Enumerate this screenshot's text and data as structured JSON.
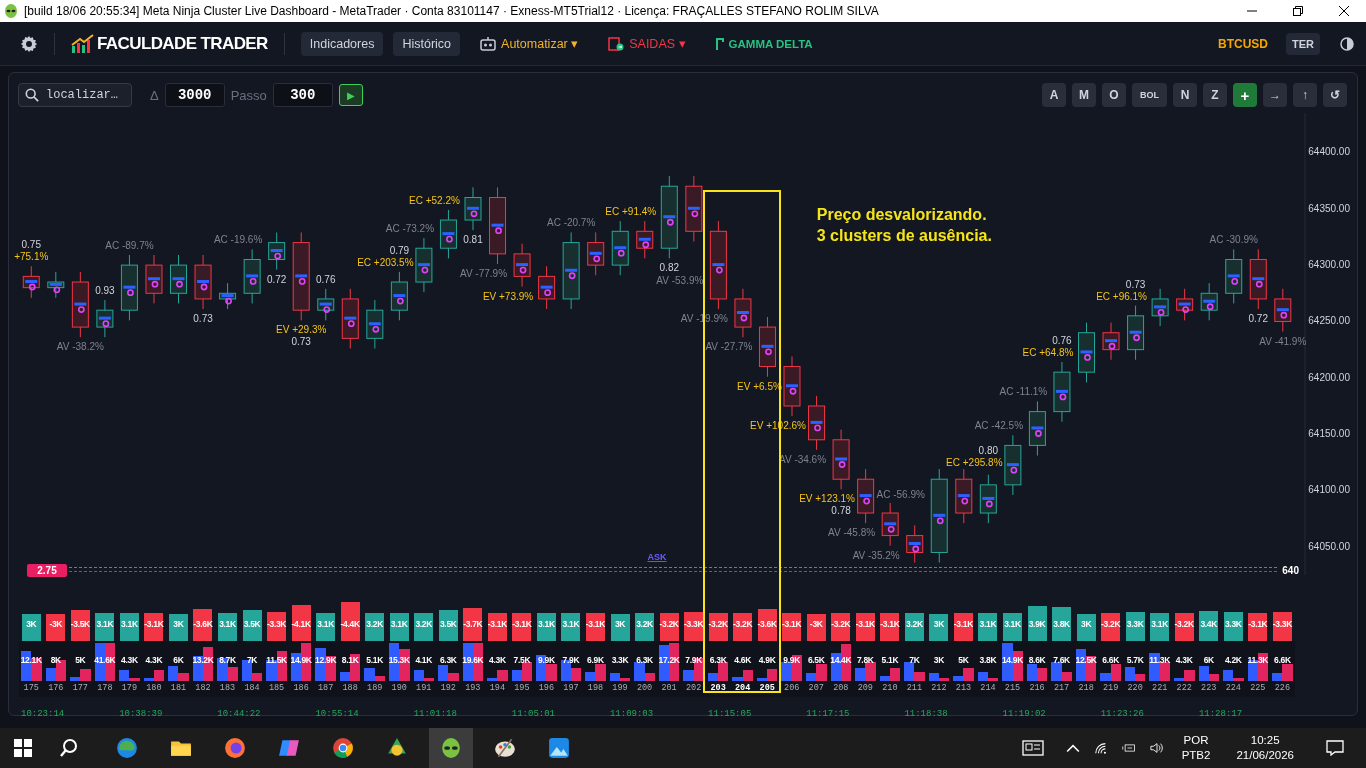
{
  "window": {
    "title": "[build 18/06 20:55:34]  Meta Ninja Cluster Live Dashboard - MetaTrader · Conta 83101147 · Exness-MT5Trial12 · Licença: FRAÇALLES STEFANO ROLIM SILVA"
  },
  "toolbar": {
    "logo": "FACULDADE TRADER",
    "buttons": [
      {
        "label": "Indicadores",
        "kind": "pill"
      },
      {
        "label": "Histórico",
        "kind": "pill"
      },
      {
        "label": "Automatizar",
        "kind": "menu",
        "color": "#f0b429",
        "caret": "▾"
      },
      {
        "label": "SAIDAS",
        "kind": "menu",
        "color": "#f23645",
        "caret": "▾"
      },
      {
        "label": "GAMMA DELTA",
        "kind": "link",
        "color": "#26c281"
      }
    ],
    "symbol": "BTCUSD",
    "timeframe": "TER"
  },
  "controls": {
    "search": {
      "placeholder": "localizar…"
    },
    "delta_label": "Δ",
    "delta": "3000",
    "step_label": "Passo",
    "step": "300",
    "play": "▶"
  },
  "tools": [
    {
      "label": "A",
      "kind": "plain"
    },
    {
      "label": "M",
      "kind": "plain"
    },
    {
      "label": "O",
      "kind": "plain"
    },
    {
      "label": "BOL",
      "kind": "plain"
    },
    {
      "label": "N",
      "kind": "plain"
    },
    {
      "label": "Z",
      "kind": "plain"
    },
    {
      "label": "+",
      "kind": "accent"
    },
    {
      "label": "→",
      "kind": "plain"
    },
    {
      "label": "↑",
      "kind": "plain"
    },
    {
      "label": "↺",
      "kind": "plain"
    }
  ],
  "chart": {
    "chart_data": {
      "type": "candlestick",
      "ylim": [
        64025,
        64435
      ],
      "yticks": [
        {
          "value": 64050,
          "label": "64050.00"
        },
        {
          "value": 64100,
          "label": "64100.00"
        },
        {
          "value": 64150,
          "label": "64150.00"
        },
        {
          "value": 64200,
          "label": "64200.00"
        },
        {
          "value": 64250,
          "label": "64250.00"
        },
        {
          "value": 64300,
          "label": "64300.00"
        },
        {
          "value": 64350,
          "label": "64350.00"
        },
        {
          "value": 64400,
          "label": "64400.00"
        }
      ],
      "ohlc": [
        [
          64290,
          64299,
          64271,
          64280
        ],
        [
          64280,
          64294,
          64271,
          64285
        ],
        [
          64285,
          64294,
          64236,
          64245
        ],
        [
          64245,
          64269,
          64236,
          64260
        ],
        [
          64260,
          64309,
          64251,
          64300
        ],
        [
          64300,
          64309,
          64266,
          64275
        ],
        [
          64275,
          64309,
          64266,
          64300
        ],
        [
          64300,
          64309,
          64261,
          64270
        ],
        [
          64270,
          64284,
          64261,
          64275
        ],
        [
          64275,
          64314,
          64266,
          64305
        ],
        [
          64305,
          64329,
          64296,
          64320
        ],
        [
          64320,
          64329,
          64251,
          64260
        ],
        [
          64260,
          64279,
          64251,
          64270
        ],
        [
          64270,
          64279,
          64226,
          64235
        ],
        [
          64235,
          64269,
          64226,
          64260
        ],
        [
          64260,
          64294,
          64251,
          64285
        ],
        [
          64285,
          64324,
          64276,
          64315
        ],
        [
          64315,
          64349,
          64306,
          64340
        ],
        [
          64340,
          64369,
          64331,
          64360
        ],
        [
          64360,
          64369,
          64301,
          64310
        ],
        [
          64310,
          64319,
          64281,
          64290
        ],
        [
          64290,
          64299,
          64261,
          64270
        ],
        [
          64270,
          64329,
          64261,
          64320
        ],
        [
          64320,
          64329,
          64291,
          64300
        ],
        [
          64300,
          64339,
          64291,
          64330
        ],
        [
          64330,
          64339,
          64306,
          64315
        ],
        [
          64315,
          64379,
          64306,
          64370
        ],
        [
          64370,
          64379,
          64321,
          64330
        ],
        [
          64330,
          64339,
          64261,
          64270
        ],
        [
          64270,
          64279,
          64236,
          64245
        ],
        [
          64245,
          64254,
          64201,
          64210
        ],
        [
          64210,
          64219,
          64166,
          64175
        ],
        [
          64175,
          64184,
          64136,
          64145
        ],
        [
          64145,
          64154,
          64101,
          64110
        ],
        [
          64110,
          64119,
          64071,
          64080
        ],
        [
          64080,
          64089,
          64051,
          64060
        ],
        [
          64060,
          64069,
          64036,
          64045
        ],
        [
          64045,
          64119,
          64036,
          64110
        ],
        [
          64110,
          64119,
          64071,
          64080
        ],
        [
          64080,
          64114,
          64071,
          64105
        ],
        [
          64105,
          64149,
          64096,
          64140
        ],
        [
          64140,
          64179,
          64131,
          64170
        ],
        [
          64170,
          64214,
          64161,
          64205
        ],
        [
          64205,
          64249,
          64196,
          64240
        ],
        [
          64240,
          64249,
          64216,
          64225
        ],
        [
          64225,
          64264,
          64216,
          64255
        ],
        [
          64255,
          64279,
          64246,
          64270
        ],
        [
          64270,
          64279,
          64251,
          64260
        ],
        [
          64260,
          64284,
          64251,
          64275
        ],
        [
          64275,
          64314,
          64266,
          64305
        ],
        [
          64305,
          64314,
          64261,
          64270
        ],
        [
          64270,
          64279,
          64241,
          64250
        ]
      ]
    },
    "note": [
      "Preço desvalorizando.",
      "3 clusters de ausência."
    ],
    "order_line": {
      "label": "2.75",
      "marker": "ASK",
      "price_label": "640"
    }
  },
  "columns": [
    {
      "index": "175",
      "delta": {
        "text": "3K",
        "kind": "buy"
      },
      "volume": "12.1K",
      "highlighted": false,
      "above": [
        {
          "text": "0.75",
          "kind": "ratio"
        },
        {
          "text": "+75.1%",
          "kind": "signal"
        }
      ]
    },
    {
      "index": "176",
      "delta": {
        "text": "-3K",
        "kind": "sell"
      },
      "volume": "8K",
      "highlighted": false
    },
    {
      "index": "177",
      "delta": {
        "text": "-3.5K",
        "kind": "sell"
      },
      "volume": "5K",
      "highlighted": false,
      "below": [
        {
          "text": "AV -38.2%",
          "kind": "stat"
        }
      ]
    },
    {
      "index": "178",
      "delta": {
        "text": "3.1K",
        "kind": "buy"
      },
      "volume": "41.6K",
      "highlighted": false,
      "above": [
        {
          "text": "0.93",
          "kind": "ratio"
        }
      ]
    },
    {
      "index": "179",
      "delta": {
        "text": "3.1K",
        "kind": "buy"
      },
      "volume": "4.3K",
      "highlighted": false,
      "above": [
        {
          "text": "AC -89.7%",
          "kind": "stat"
        }
      ]
    },
    {
      "index": "180",
      "delta": {
        "text": "-3.1K",
        "kind": "sell"
      },
      "volume": "4.3K",
      "highlighted": false
    },
    {
      "index": "181",
      "delta": {
        "text": "3K",
        "kind": "buy"
      },
      "volume": "6K",
      "highlighted": false
    },
    {
      "index": "182",
      "delta": {
        "text": "-3.6K",
        "kind": "sell"
      },
      "volume": "13.2K",
      "highlighted": false,
      "below": [
        {
          "text": "0.73",
          "kind": "ratio"
        }
      ]
    },
    {
      "index": "183",
      "delta": {
        "text": "3.1K",
        "kind": "buy"
      },
      "volume": "8.7K",
      "highlighted": false
    },
    {
      "index": "184",
      "delta": {
        "text": "3.5K",
        "kind": "buy"
      },
      "volume": "7K",
      "highlighted": false,
      "above": [
        {
          "text": "AC -19.6%",
          "kind": "stat"
        }
      ]
    },
    {
      "index": "185",
      "delta": {
        "text": "-3.3K",
        "kind": "sell"
      },
      "volume": "11.5K",
      "highlighted": false,
      "below": [
        {
          "text": "0.72",
          "kind": "ratio"
        }
      ]
    },
    {
      "index": "186",
      "delta": {
        "text": "-4.1K",
        "kind": "sell"
      },
      "volume": "14.9K",
      "highlighted": false,
      "below": [
        {
          "text": "EV +29.3%",
          "kind": "signal"
        },
        {
          "text": "0.73",
          "kind": "ratio"
        }
      ]
    },
    {
      "index": "187",
      "delta": {
        "text": "3.1K",
        "kind": "buy"
      },
      "volume": "12.9K",
      "highlighted": false,
      "above": [
        {
          "text": "0.76",
          "kind": "ratio"
        }
      ]
    },
    {
      "index": "188",
      "delta": {
        "text": "-4.4K",
        "kind": "sell"
      },
      "volume": "8.1K",
      "highlighted": false
    },
    {
      "index": "189",
      "delta": {
        "text": "3.2K",
        "kind": "buy"
      },
      "volume": "5.1K",
      "highlighted": false
    },
    {
      "index": "190",
      "delta": {
        "text": "3.1K",
        "kind": "buy"
      },
      "volume": "15.3K",
      "highlighted": false,
      "above": [
        {
          "text": "0.79",
          "kind": "ratio"
        },
        {
          "text": "EC +203.5%",
          "kind": "signal"
        }
      ]
    },
    {
      "index": "191",
      "delta": {
        "text": "3.2K",
        "kind": "buy"
      },
      "volume": "4.1K",
      "highlighted": false,
      "above": [
        {
          "text": "AC -73.2%",
          "kind": "stat"
        }
      ]
    },
    {
      "index": "192",
      "delta": {
        "text": "3.5K",
        "kind": "buy"
      },
      "volume": "6.3K",
      "highlighted": false,
      "above": [
        {
          "text": "EC +52.2%",
          "kind": "signal"
        }
      ]
    },
    {
      "index": "193",
      "delta": {
        "text": "-3.7K",
        "kind": "sell"
      },
      "volume": "19.6K",
      "highlighted": false,
      "below": [
        {
          "text": "0.81",
          "kind": "ratio"
        }
      ]
    },
    {
      "index": "194",
      "delta": {
        "text": "-3.1K",
        "kind": "sell"
      },
      "volume": "4.3K",
      "highlighted": false,
      "below": [
        {
          "text": "AV -77.9%",
          "kind": "stat"
        }
      ]
    },
    {
      "index": "195",
      "delta": {
        "text": "-3.1K",
        "kind": "sell"
      },
      "volume": "7.5K",
      "highlighted": false,
      "below": [
        {
          "text": "EV +73.9%",
          "kind": "signal"
        }
      ]
    },
    {
      "index": "196",
      "delta": {
        "text": "3.1K",
        "kind": "buy"
      },
      "volume": "9.9K",
      "highlighted": false
    },
    {
      "index": "197",
      "delta": {
        "text": "3.1K",
        "kind": "buy"
      },
      "volume": "7.9K",
      "highlighted": false,
      "above": [
        {
          "text": "AC -20.7%",
          "kind": "stat"
        }
      ]
    },
    {
      "index": "198",
      "delta": {
        "text": "-3.1K",
        "kind": "sell"
      },
      "volume": "6.9K",
      "highlighted": false
    },
    {
      "index": "199",
      "delta": {
        "text": "3K",
        "kind": "buy"
      },
      "volume": "3.3K",
      "highlighted": false
    },
    {
      "index": "200",
      "delta": {
        "text": "3.2K",
        "kind": "buy"
      },
      "volume": "6.3K",
      "highlighted": false,
      "above": [
        {
          "text": "EC +91.4%",
          "kind": "signal"
        }
      ]
    },
    {
      "index": "201",
      "delta": {
        "text": "-3.2K",
        "kind": "sell"
      },
      "volume": "17.2K",
      "highlighted": false,
      "below": [
        {
          "text": "0.82",
          "kind": "ratio"
        }
      ]
    },
    {
      "index": "202",
      "delta": {
        "text": "-3.3K",
        "kind": "sell"
      },
      "volume": "7.9K",
      "highlighted": false,
      "below": [
        {
          "text": "AV -53.9%",
          "kind": "stat"
        }
      ]
    },
    {
      "index": "203",
      "delta": {
        "text": "-3.2K",
        "kind": "sell"
      },
      "volume": "6.3K",
      "highlighted": true,
      "below": [
        {
          "text": "AV -19.9%",
          "kind": "stat"
        }
      ]
    },
    {
      "index": "204",
      "delta": {
        "text": "-3.2K",
        "kind": "sell"
      },
      "volume": "4.6K",
      "highlighted": true,
      "below": [
        {
          "text": "AV -27.7%",
          "kind": "stat"
        }
      ]
    },
    {
      "index": "205",
      "delta": {
        "text": "-3.6K",
        "kind": "sell"
      },
      "volume": "4.9K",
      "highlighted": true,
      "below": [
        {
          "text": "EV +6.5%",
          "kind": "signal"
        }
      ]
    },
    {
      "index": "206",
      "delta": {
        "text": "-3.1K",
        "kind": "sell"
      },
      "volume": "9.9K",
      "highlighted": false,
      "below": [
        {
          "text": "EV +102.6%",
          "kind": "signal"
        }
      ]
    },
    {
      "index": "207",
      "delta": {
        "text": "-3K",
        "kind": "sell"
      },
      "volume": "6.5K",
      "highlighted": false,
      "below": [
        {
          "text": "AV -34.6%",
          "kind": "stat"
        }
      ]
    },
    {
      "index": "208",
      "delta": {
        "text": "-3.2K",
        "kind": "sell"
      },
      "volume": "14.4K",
      "highlighted": false,
      "below": [
        {
          "text": "EV +123.1%",
          "kind": "signal"
        },
        {
          "text": "0.78",
          "kind": "ratio"
        }
      ]
    },
    {
      "index": "209",
      "delta": {
        "text": "-3.1K",
        "kind": "sell"
      },
      "volume": "7.8K",
      "highlighted": false,
      "below": [
        {
          "text": "AV -45.8%",
          "kind": "stat"
        }
      ]
    },
    {
      "index": "210",
      "delta": {
        "text": "-3.1K",
        "kind": "sell"
      },
      "volume": "5.1K",
      "highlighted": false,
      "below": [
        {
          "text": "AV -35.2%",
          "kind": "stat"
        }
      ]
    },
    {
      "index": "211",
      "delta": {
        "text": "3.2K",
        "kind": "buy"
      },
      "volume": "7K",
      "highlighted": false,
      "above": [
        {
          "text": "AC -56.9%",
          "kind": "stat"
        }
      ]
    },
    {
      "index": "212",
      "delta": {
        "text": "3K",
        "kind": "buy"
      },
      "volume": "3K",
      "highlighted": false
    },
    {
      "index": "213",
      "delta": {
        "text": "-3.1K",
        "kind": "sell"
      },
      "volume": "5K",
      "highlighted": false
    },
    {
      "index": "214",
      "delta": {
        "text": "3.1K",
        "kind": "buy"
      },
      "volume": "3.8K",
      "highlighted": false,
      "above": [
        {
          "text": "0.80",
          "kind": "ratio"
        },
        {
          "text": "EC +295.8%",
          "kind": "signal"
        }
      ]
    },
    {
      "index": "215",
      "delta": {
        "text": "3.1K",
        "kind": "buy"
      },
      "volume": "14.9K",
      "highlighted": false,
      "above": [
        {
          "text": "AC -42.5%",
          "kind": "stat"
        }
      ]
    },
    {
      "index": "216",
      "delta": {
        "text": "3.9K",
        "kind": "buy"
      },
      "volume": "8.6K",
      "highlighted": false,
      "above": [
        {
          "text": "AC -11.1%",
          "kind": "stat"
        }
      ]
    },
    {
      "index": "217",
      "delta": {
        "text": "3.8K",
        "kind": "buy"
      },
      "volume": "7.6K",
      "highlighted": false,
      "above": [
        {
          "text": "0.76",
          "kind": "ratio"
        },
        {
          "text": "EC +64.8%",
          "kind": "signal"
        }
      ]
    },
    {
      "index": "218",
      "delta": {
        "text": "3K",
        "kind": "buy"
      },
      "volume": "12.5K",
      "highlighted": false
    },
    {
      "index": "219",
      "delta": {
        "text": "-3.2K",
        "kind": "sell"
      },
      "volume": "6.6K",
      "highlighted": false
    },
    {
      "index": "220",
      "delta": {
        "text": "3.3K",
        "kind": "buy"
      },
      "volume": "5.7K",
      "highlighted": false,
      "above": [
        {
          "text": "0.73",
          "kind": "ratio"
        },
        {
          "text": "EC +96.1%",
          "kind": "signal"
        }
      ]
    },
    {
      "index": "221",
      "delta": {
        "text": "3.1K",
        "kind": "buy"
      },
      "volume": "11.3K",
      "highlighted": false
    },
    {
      "index": "222",
      "delta": {
        "text": "-3.2K",
        "kind": "sell"
      },
      "volume": "4.3K",
      "highlighted": false
    },
    {
      "index": "223",
      "delta": {
        "text": "3.4K",
        "kind": "buy"
      },
      "volume": "6K",
      "highlighted": false
    },
    {
      "index": "224",
      "delta": {
        "text": "3.3K",
        "kind": "buy"
      },
      "volume": "4.2K",
      "highlighted": false,
      "above": [
        {
          "text": "AC -30.9%",
          "kind": "stat"
        }
      ]
    },
    {
      "index": "225",
      "delta": {
        "text": "-3.1K",
        "kind": "sell"
      },
      "volume": "11.3K",
      "highlighted": false,
      "below": [
        {
          "text": "0.72",
          "kind": "ratio"
        }
      ]
    },
    {
      "index": "226",
      "delta": {
        "text": "-3.3K",
        "kind": "sell"
      },
      "volume": "6.6K",
      "highlighted": false,
      "below": [
        {
          "text": "AV -41.9%",
          "kind": "stat"
        }
      ]
    }
  ],
  "times": [
    "10:23:14",
    "10:38:39",
    "10:44:22",
    "10:55:14",
    "11:01:18",
    "11:05:01",
    "11:09:03",
    "11:15:05",
    "11:17:15",
    "11:18:38",
    "11:19:02",
    "11:23:26",
    "11:28:17"
  ],
  "taskbar": {
    "apps": [
      {
        "selected": false
      },
      {
        "selected": false
      },
      {
        "selected": false
      },
      {
        "selected": false
      },
      {
        "selected": false
      },
      {
        "selected": false
      },
      {
        "selected": true
      },
      {
        "selected": false
      },
      {
        "selected": false
      }
    ],
    "language": "POR",
    "layout": "PTB2",
    "time": "10:25",
    "date": "21/06/2026"
  }
}
